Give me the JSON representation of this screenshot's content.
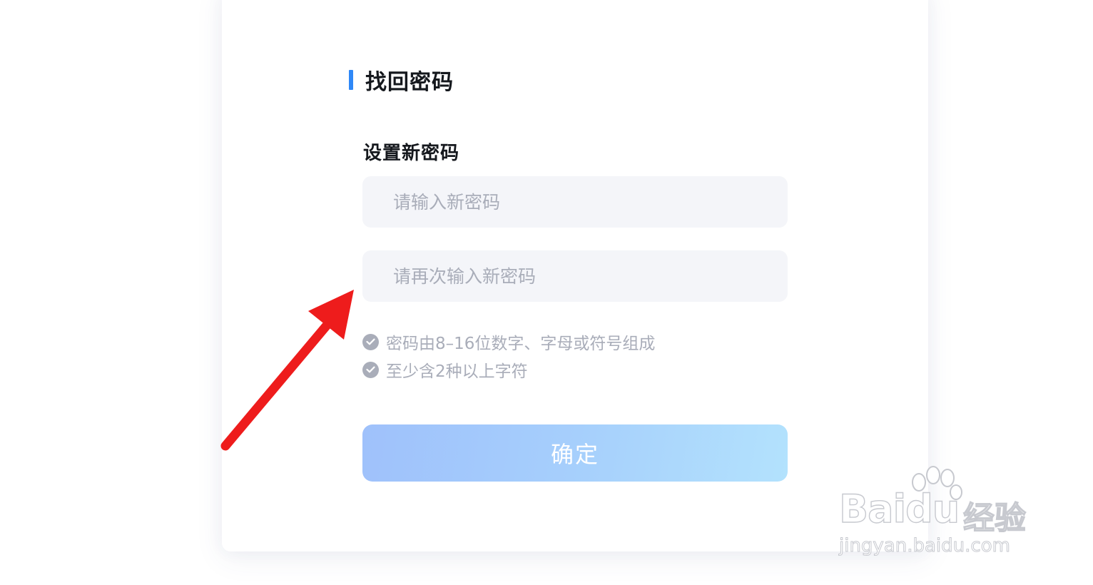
{
  "page": {
    "title": "找回密码",
    "section_label": "设置新密码"
  },
  "form": {
    "new_password": {
      "value": "",
      "placeholder": "请输入新密码"
    },
    "confirm_password": {
      "value": "",
      "placeholder": "请再次输入新密码"
    },
    "rules": [
      {
        "text": "密码由8–16位数字、字母或符号组成",
        "icon": "check-circle-icon"
      },
      {
        "text": "至少含2种以上字符",
        "icon": "check-circle-icon"
      }
    ],
    "submit_label": "确定"
  },
  "watermark": {
    "brand": "Baidu",
    "cn": "经验",
    "url": "jingyan.baidu.com"
  },
  "colors": {
    "accent": "#2f88f7",
    "button_gradient_start": "#9fc1fb",
    "button_gradient_end": "#b3e2fd",
    "field_bg": "#f4f5f9",
    "hint": "#a9adb9",
    "annotation_arrow": "#ee1c1c"
  }
}
